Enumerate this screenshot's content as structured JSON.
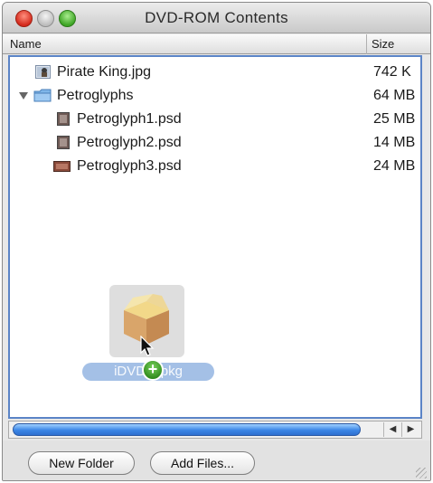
{
  "window": {
    "title": "DVD-ROM Contents"
  },
  "columns": {
    "name": "Name",
    "size": "Size"
  },
  "rows": [
    {
      "name": "Pirate King.jpg",
      "size": "742 K",
      "indent": 0,
      "icon": "image-file-icon"
    },
    {
      "name": "Petroglyphs",
      "size": "64 MB",
      "indent": 0,
      "icon": "folder-icon",
      "expanded": true
    },
    {
      "name": "Petroglyph1.psd",
      "size": "25 MB",
      "indent": 1,
      "icon": "psd-file-icon"
    },
    {
      "name": "Petroglyph2.psd",
      "size": "14 MB",
      "indent": 1,
      "icon": "psd-file-icon"
    },
    {
      "name": "Petroglyph3.psd",
      "size": "24 MB",
      "indent": 1,
      "icon": "psd-file-icon"
    }
  ],
  "drag": {
    "label": "iDVD_ .pkg",
    "badge": "+"
  },
  "buttons": {
    "new_folder": "New Folder",
    "add_files": "Add Files..."
  },
  "scroll_arrows": {
    "left": "◀",
    "right": "▶"
  },
  "colors": {
    "selection": "#5b84c7",
    "scroll_thumb": "#3b86e6"
  }
}
